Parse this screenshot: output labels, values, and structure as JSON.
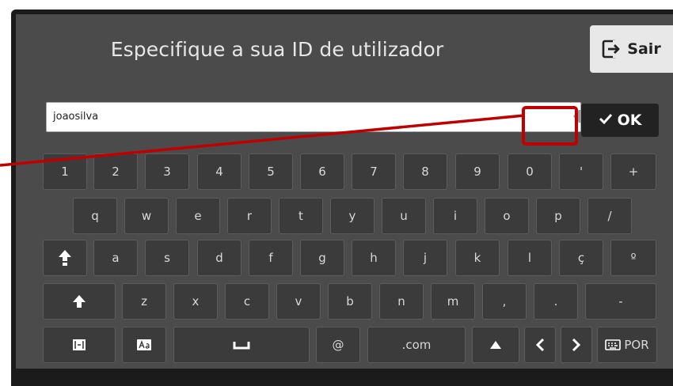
{
  "dialog": {
    "title": "Especifique a sua ID de utilizador",
    "exit_label": "Sair"
  },
  "input": {
    "value": "joaosilva"
  },
  "ok_label": "OK",
  "keyboard": {
    "row1": [
      "1",
      "2",
      "3",
      "4",
      "5",
      "6",
      "7",
      "8",
      "9",
      "0",
      "'",
      "+"
    ],
    "row2": [
      "q",
      "w",
      "e",
      "r",
      "t",
      "y",
      "u",
      "i",
      "o",
      "p",
      "/"
    ],
    "row3": [
      "a",
      "s",
      "d",
      "f",
      "g",
      "h",
      "j",
      "k",
      "l",
      "ç",
      "º"
    ],
    "row4": [
      "z",
      "x",
      "c",
      "v",
      "b",
      "n",
      "m",
      ",",
      ".",
      "-"
    ],
    "row5": {
      "at": "@",
      "dotcom": ".com",
      "language": "POR"
    }
  },
  "colors": {
    "highlight": "#c00000",
    "screen": "#4b4b4b",
    "key": "#3b3b3b"
  },
  "icons": [
    "exit-icon",
    "backspace-icon",
    "checkmark-icon",
    "caps-lock-icon",
    "shift-icon",
    "symbols-icon",
    "case-icon",
    "space-icon",
    "up-arrow-icon",
    "left-arrow-icon",
    "right-arrow-icon",
    "keyboard-icon"
  ]
}
